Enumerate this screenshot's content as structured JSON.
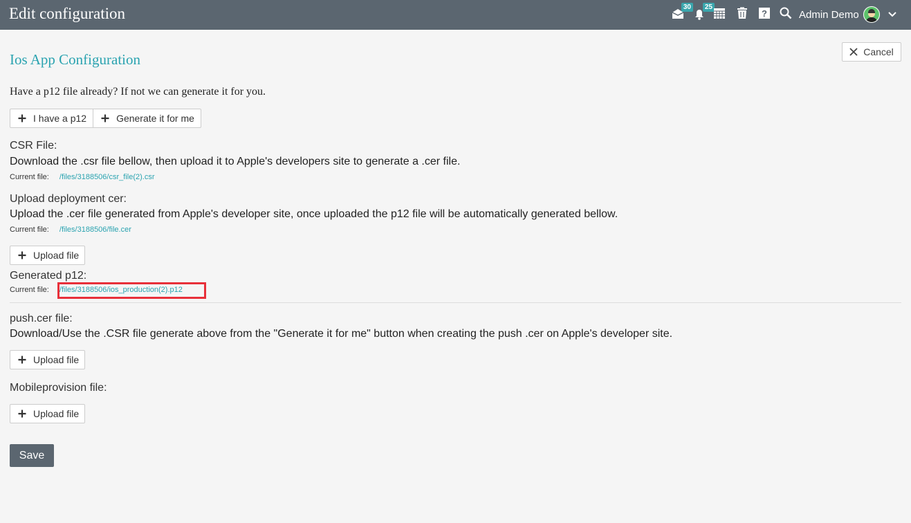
{
  "header": {
    "title": "Edit configuration",
    "messages_badge": "30",
    "notifications_badge": "25",
    "username": "Admin Demo"
  },
  "cancel_label": "Cancel",
  "page_title": "Ios App Configuration",
  "question": "Have a p12 file already? If not we can generate it for you.",
  "options": {
    "have_p12": "I have a p12",
    "generate": "Generate it for me"
  },
  "current_file_label": "Current file:",
  "csr": {
    "label": "CSR File:",
    "description": "Download the .csr file bellow, then upload it to Apple's developers site to generate a .cer file.",
    "file": "/files/3188506/csr_file(2).csr"
  },
  "deployment": {
    "label": "Upload deployment cer:",
    "description": "Upload the .cer file generated from Apple's developer site, once uploaded the p12 file will be automatically generated bellow.",
    "file": "/files/3188506/file.cer",
    "upload_label": "Upload file"
  },
  "generated": {
    "label": "Generated p12:",
    "file": "/files/3188506/ios_production(2).p12"
  },
  "push": {
    "label": "push.cer file:",
    "description": "Download/Use the .CSR file generate above from the \"Generate it for me\" button when creating the push .cer on Apple's developer site.",
    "upload_label": "Upload file"
  },
  "mobileprovision": {
    "label": "Mobileprovision file:",
    "upload_label": "Upload file"
  },
  "save_label": "Save",
  "colors": {
    "topbar": "#5b6670",
    "accent": "#2aa3b0",
    "highlight": "#e8303a"
  }
}
